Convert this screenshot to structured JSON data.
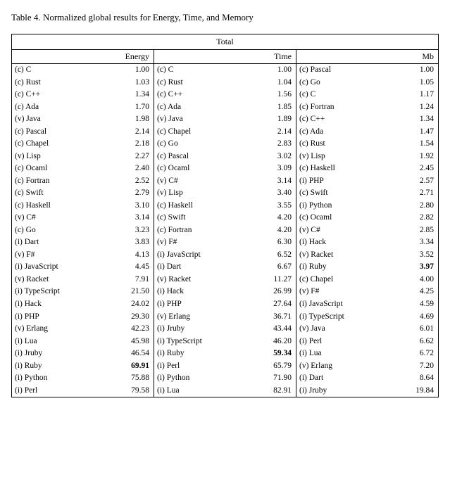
{
  "title": {
    "bold_part": "Table 4.",
    "normal_part": " Normalized global results for Energy, Time, and Memory"
  },
  "total_label": "Total",
  "sections": [
    {
      "header": "Energy",
      "rows": [
        {
          "lang": "(c) C",
          "val": "1.00"
        },
        {
          "lang": "(c) Rust",
          "val": "1.03"
        },
        {
          "lang": "(c) C++",
          "val": "1.34"
        },
        {
          "lang": "(c) Ada",
          "val": "1.70"
        },
        {
          "lang": "(v) Java",
          "val": "1.98"
        },
        {
          "lang": "(c) Pascal",
          "val": "2.14"
        },
        {
          "lang": "(c) Chapel",
          "val": "2.18"
        },
        {
          "lang": "(v) Lisp",
          "val": "2.27"
        },
        {
          "lang": "(c) Ocaml",
          "val": "2.40"
        },
        {
          "lang": "(c) Fortran",
          "val": "2.52"
        },
        {
          "lang": "(c) Swift",
          "val": "2.79"
        },
        {
          "lang": "(c) Haskell",
          "val": "3.10"
        },
        {
          "lang": "(v) C#",
          "val": "3.14"
        },
        {
          "lang": "(c) Go",
          "val": "3.23"
        },
        {
          "lang": "(i) Dart",
          "val": "3.83"
        },
        {
          "lang": "(v) F#",
          "val": "4.13"
        },
        {
          "lang": "(i) JavaScript",
          "val": "4.45"
        },
        {
          "lang": "(v) Racket",
          "val": "7.91"
        },
        {
          "lang": "(i) TypeScript",
          "val": "21.50"
        },
        {
          "lang": "(i) Hack",
          "val": "24.02"
        },
        {
          "lang": "(i) PHP",
          "val": "29.30"
        },
        {
          "lang": "(v) Erlang",
          "val": "42.23"
        },
        {
          "lang": "(i) Lua",
          "val": "45.98"
        },
        {
          "lang": "(i) Jruby",
          "val": "46.54"
        },
        {
          "lang": "(i) Ruby",
          "val": "69.91",
          "bold": true
        },
        {
          "lang": "(i) Python",
          "val": "75.88"
        },
        {
          "lang": "(i) Perl",
          "val": "79.58"
        }
      ]
    },
    {
      "header": "Time",
      "rows": [
        {
          "lang": "(c) C",
          "val": "1.00"
        },
        {
          "lang": "(c) Rust",
          "val": "1.04"
        },
        {
          "lang": "(c) C++",
          "val": "1.56"
        },
        {
          "lang": "(c) Ada",
          "val": "1.85"
        },
        {
          "lang": "(v) Java",
          "val": "1.89"
        },
        {
          "lang": "(c) Chapel",
          "val": "2.14"
        },
        {
          "lang": "(c) Go",
          "val": "2.83"
        },
        {
          "lang": "(c) Pascal",
          "val": "3.02"
        },
        {
          "lang": "(c) Ocaml",
          "val": "3.09"
        },
        {
          "lang": "(v) C#",
          "val": "3.14"
        },
        {
          "lang": "(v) Lisp",
          "val": "3.40"
        },
        {
          "lang": "(c) Haskell",
          "val": "3.55"
        },
        {
          "lang": "(c) Swift",
          "val": "4.20"
        },
        {
          "lang": "(c) Fortran",
          "val": "4.20"
        },
        {
          "lang": "(v) F#",
          "val": "6.30"
        },
        {
          "lang": "(i) JavaScript",
          "val": "6.52"
        },
        {
          "lang": "(i) Dart",
          "val": "6.67"
        },
        {
          "lang": "(v) Racket",
          "val": "11.27"
        },
        {
          "lang": "(i) Hack",
          "val": "26.99"
        },
        {
          "lang": "(i) PHP",
          "val": "27.64"
        },
        {
          "lang": "(v) Erlang",
          "val": "36.71"
        },
        {
          "lang": "(i) Jruby",
          "val": "43.44"
        },
        {
          "lang": "(i) TypeScript",
          "val": "46.20"
        },
        {
          "lang": "(i) Ruby",
          "val": "59.34",
          "bold": true
        },
        {
          "lang": "(i) Perl",
          "val": "65.79"
        },
        {
          "lang": "(i) Python",
          "val": "71.90"
        },
        {
          "lang": "(i) Lua",
          "val": "82.91"
        }
      ]
    },
    {
      "header": "Mb",
      "rows": [
        {
          "lang": "(c) Pascal",
          "val": "1.00"
        },
        {
          "lang": "(c) Go",
          "val": "1.05"
        },
        {
          "lang": "(c) C",
          "val": "1.17"
        },
        {
          "lang": "(c) Fortran",
          "val": "1.24"
        },
        {
          "lang": "(c) C++",
          "val": "1.34"
        },
        {
          "lang": "(c) Ada",
          "val": "1.47"
        },
        {
          "lang": "(c) Rust",
          "val": "1.54"
        },
        {
          "lang": "(v) Lisp",
          "val": "1.92"
        },
        {
          "lang": "(c) Haskell",
          "val": "2.45"
        },
        {
          "lang": "(i) PHP",
          "val": "2.57"
        },
        {
          "lang": "(c) Swift",
          "val": "2.71"
        },
        {
          "lang": "(i) Python",
          "val": "2.80"
        },
        {
          "lang": "(c) Ocaml",
          "val": "2.82"
        },
        {
          "lang": "(v) C#",
          "val": "2.85"
        },
        {
          "lang": "(i) Hack",
          "val": "3.34"
        },
        {
          "lang": "(v) Racket",
          "val": "3.52"
        },
        {
          "lang": "(i) Ruby",
          "val": "3.97",
          "bold": true
        },
        {
          "lang": "(c) Chapel",
          "val": "4.00"
        },
        {
          "lang": "(v) F#",
          "val": "4.25"
        },
        {
          "lang": "(i) JavaScript",
          "val": "4.59"
        },
        {
          "lang": "(i) TypeScript",
          "val": "4.69"
        },
        {
          "lang": "(v) Java",
          "val": "6.01"
        },
        {
          "lang": "(i) Perl",
          "val": "6.62"
        },
        {
          "lang": "(i) Lua",
          "val": "6.72"
        },
        {
          "lang": "(v) Erlang",
          "val": "7.20"
        },
        {
          "lang": "(i) Dart",
          "val": "8.64"
        },
        {
          "lang": "(i) Jruby",
          "val": "19.84"
        }
      ]
    }
  ]
}
